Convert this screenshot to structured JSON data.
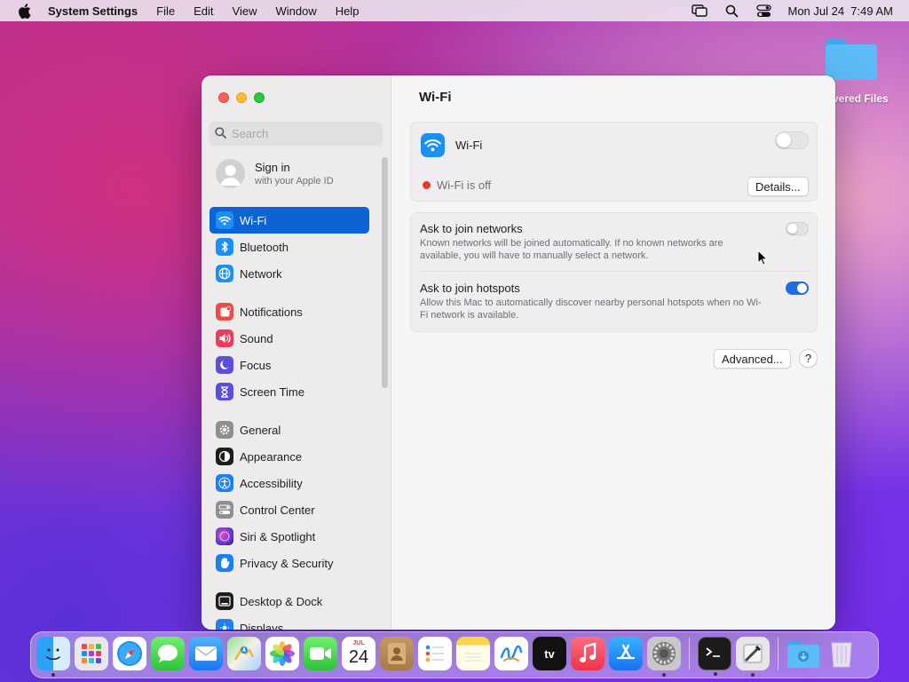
{
  "menubar": {
    "app_name": "System Settings",
    "menus": [
      "File",
      "Edit",
      "View",
      "Window",
      "Help"
    ],
    "clock": "Mon Jul 24  7:49 AM",
    "status_icons": [
      "screen-mirroring-icon",
      "spotlight-search-icon",
      "control-center-icon"
    ]
  },
  "desktop": {
    "folder_label": "vered Files"
  },
  "sidebar": {
    "search_placeholder": "Search",
    "signin_title": "Sign in",
    "signin_subtitle": "with your Apple ID",
    "items": [
      {
        "label": "Wi-Fi",
        "icon": "wifi-icon",
        "color": "#1c8ff3",
        "active": true
      },
      {
        "label": "Bluetooth",
        "icon": "bluetooth-icon",
        "color": "#1c8ff3"
      },
      {
        "label": "Network",
        "icon": "globe-icon",
        "color": "#1c8ff3"
      },
      {
        "label": "Notifications",
        "icon": "bell-icon",
        "color": "#ef4a4a"
      },
      {
        "label": "Sound",
        "icon": "speaker-icon",
        "color": "#ef3a5d"
      },
      {
        "label": "Focus",
        "icon": "moon-icon",
        "color": "#5a4fd8"
      },
      {
        "label": "Screen Time",
        "icon": "hourglass-icon",
        "color": "#5a4fd8"
      },
      {
        "label": "General",
        "icon": "gear-icon",
        "color": "#8e8e93"
      },
      {
        "label": "Appearance",
        "icon": "appearance-icon",
        "color": "#1d1d1f"
      },
      {
        "label": "Accessibility",
        "icon": "accessibility-icon",
        "color": "#1c7ff3"
      },
      {
        "label": "Control Center",
        "icon": "control-center-icon",
        "color": "#8e8e93"
      },
      {
        "label": "Siri & Spotlight",
        "icon": "siri-icon",
        "color": "#6a3bd8"
      },
      {
        "label": "Privacy & Security",
        "icon": "hand-icon",
        "color": "#1c7ff3"
      },
      {
        "label": "Desktop & Dock",
        "icon": "dock-icon",
        "color": "#1d1d1f"
      },
      {
        "label": "Displays",
        "icon": "display-icon",
        "color": "#1c7ff3"
      }
    ]
  },
  "content": {
    "title": "Wi-Fi",
    "wifi_label": "Wi-Fi",
    "wifi_enabled": false,
    "status_text": "Wi-Fi is off",
    "details_button": "Details...",
    "ask_networks_title": "Ask to join networks",
    "ask_networks_desc": "Known networks will be joined automatically. If no known networks are available, you will have to manually select a network.",
    "ask_networks_enabled": false,
    "ask_hotspots_title": "Ask to join hotspots",
    "ask_hotspots_desc": "Allow this Mac to automatically discover nearby personal hotspots when no Wi-Fi network is available.",
    "ask_hotspots_enabled": true,
    "advanced_button": "Advanced...",
    "help_button": "?"
  },
  "dock": {
    "calendar_month": "JUL",
    "calendar_day": "24",
    "apps": [
      "finder-icon",
      "launchpad-icon",
      "safari-icon",
      "messages-icon",
      "mail-icon",
      "maps-icon",
      "photos-icon",
      "facetime-icon",
      "calendar-icon",
      "contacts-icon",
      "reminders-icon",
      "notes-icon",
      "freeform-icon",
      "apple-tv-icon",
      "music-icon",
      "app-store-icon",
      "system-settings-icon",
      "terminal-icon",
      "script-editor-icon",
      "downloads-folder-icon",
      "trash-icon"
    ],
    "tv_label": "tv"
  }
}
